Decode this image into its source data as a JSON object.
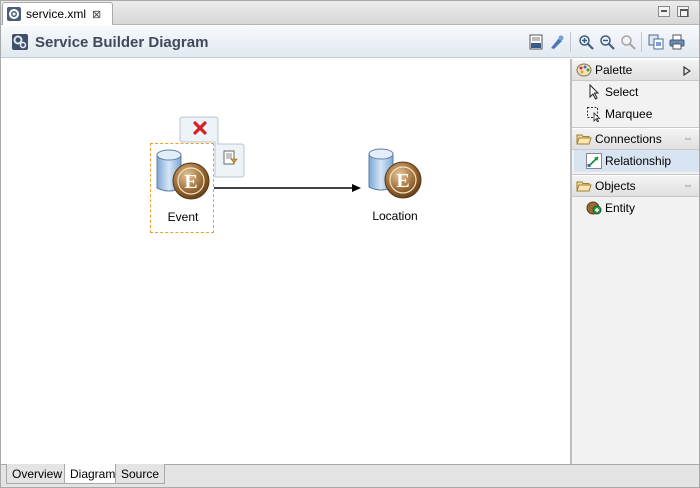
{
  "editor_tab": {
    "label": "service.xml",
    "close_glyph": "⊠"
  },
  "title": "Service Builder Diagram",
  "toolbar": {
    "icons": [
      "binary-icon",
      "layout-icon",
      "zoom-in-icon",
      "zoom-out-icon",
      "zoom-fit-icon",
      "copy-image-icon",
      "print-icon"
    ]
  },
  "diagram": {
    "entities": [
      {
        "label": "Event",
        "letter": "E",
        "selected": true
      },
      {
        "label": "Location",
        "letter": "E",
        "selected": false
      }
    ],
    "connection": {
      "from": "Event",
      "to": "Location"
    }
  },
  "palette": {
    "header": "Palette",
    "tools": [
      {
        "label": "Select"
      },
      {
        "label": "Marquee"
      }
    ],
    "groups": [
      {
        "label": "Connections",
        "items": [
          {
            "label": "Relationship",
            "selected": true
          }
        ]
      },
      {
        "label": "Objects",
        "items": [
          {
            "label": "Entity",
            "selected": false
          }
        ]
      }
    ]
  },
  "bottom_tabs": [
    {
      "label": "Overview",
      "active": false
    },
    {
      "label": "Diagram",
      "active": true
    },
    {
      "label": "Source",
      "active": false
    }
  ],
  "colors": {
    "entity_brown": "#9a6a34",
    "entity_cylinder": "#a9c8e8",
    "selection_border": "#f0a030",
    "delete_red": "#d42020"
  }
}
